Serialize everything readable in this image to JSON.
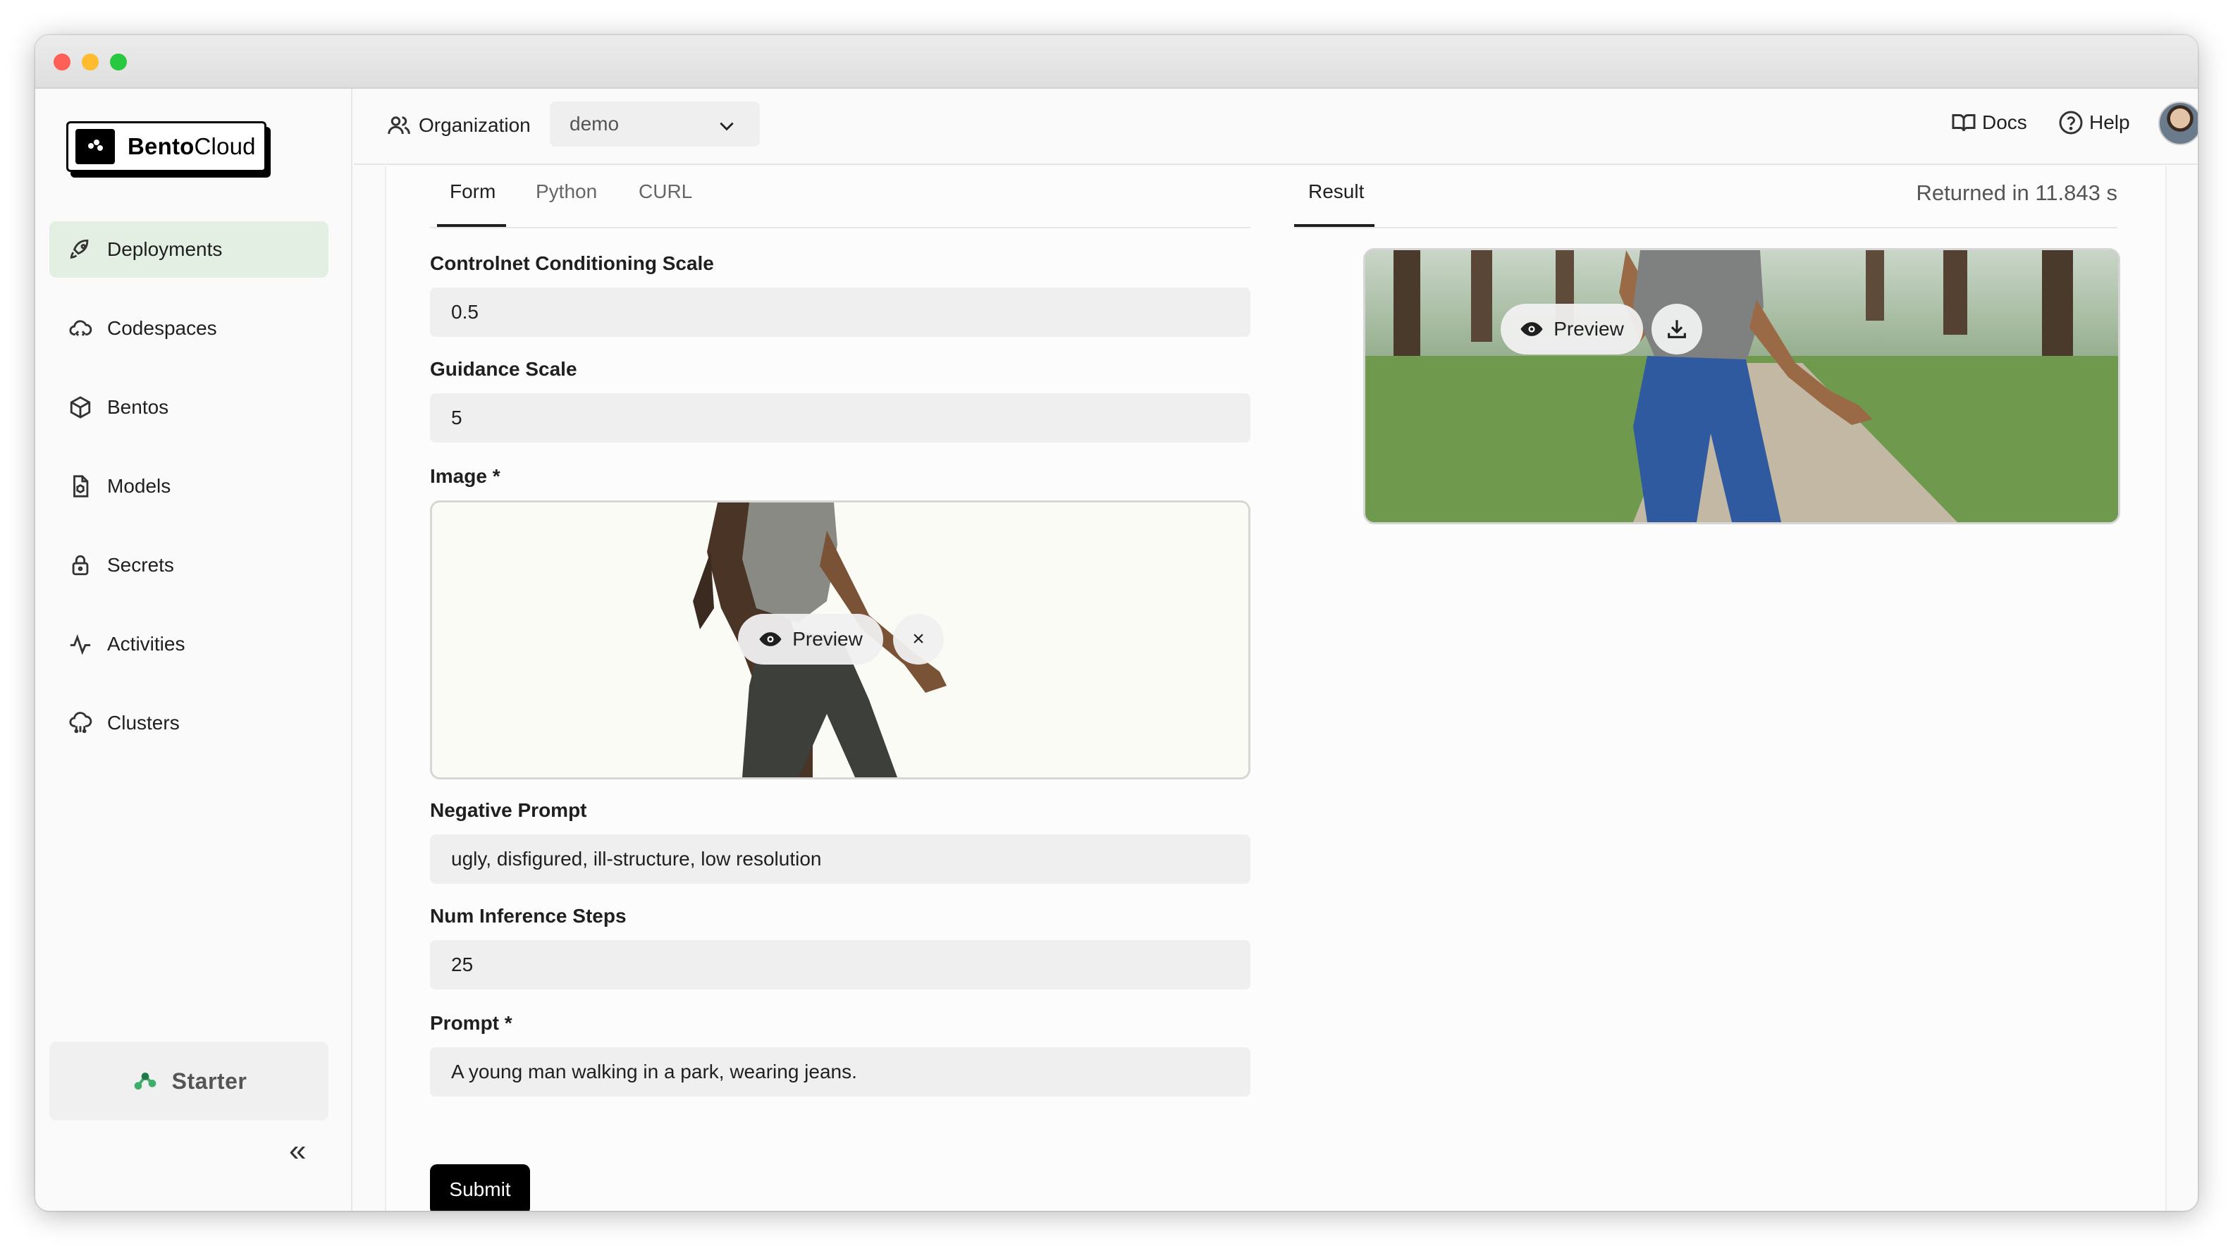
{
  "sidebar": {
    "logo": {
      "brand_bold": "Bento",
      "brand_rest": "Cloud"
    },
    "items": [
      {
        "label": "Deployments",
        "icon": "rocket-icon",
        "active": true
      },
      {
        "label": "Codespaces",
        "icon": "cloud-code-icon"
      },
      {
        "label": "Bentos",
        "icon": "box-icon"
      },
      {
        "label": "Models",
        "icon": "model-file-icon"
      },
      {
        "label": "Secrets",
        "icon": "lock-icon"
      },
      {
        "label": "Activities",
        "icon": "activity-icon"
      },
      {
        "label": "Clusters",
        "icon": "cloud-cluster-icon"
      }
    ],
    "plan": {
      "label": "Starter",
      "icon": "starter-nodes-icon"
    },
    "collapse_label": "«"
  },
  "topbar": {
    "org_label": "Organization",
    "org_value": "demo",
    "docs_label": "Docs",
    "help_label": "Help"
  },
  "form": {
    "tabs": [
      {
        "label": "Form",
        "active": true
      },
      {
        "label": "Python"
      },
      {
        "label": "CURL"
      }
    ],
    "fields": {
      "controlnet": {
        "label": "Controlnet Conditioning Scale",
        "value": "0.5"
      },
      "guidance": {
        "label": "Guidance Scale",
        "value": "5"
      },
      "image": {
        "label": "Image *",
        "preview_label": "Preview",
        "remove_label": "×"
      },
      "negative": {
        "label": "Negative Prompt",
        "value": "ugly, disfigured, ill-structure, low resolution"
      },
      "steps": {
        "label": "Num Inference Steps",
        "value": "25"
      },
      "prompt": {
        "label": "Prompt *",
        "value": "A young man walking in a park, wearing jeans."
      }
    },
    "submit_label": "Submit"
  },
  "result": {
    "tab_label": "Result",
    "returned": "Returned in 11.843 s",
    "preview_label": "Preview"
  },
  "colors": {
    "accent": "#e4efe3",
    "brand_green": "#3fae6a"
  }
}
